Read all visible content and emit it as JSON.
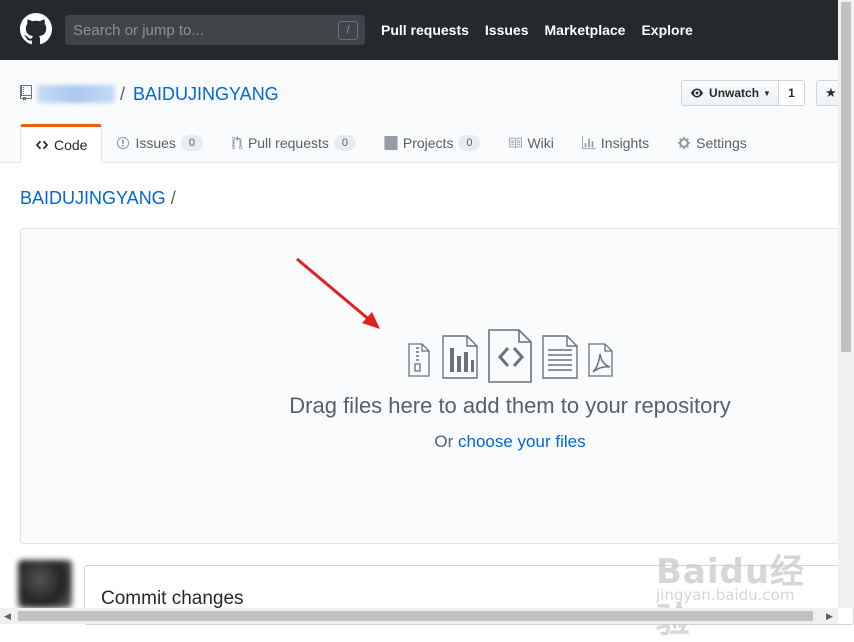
{
  "header": {
    "search_placeholder": "Search or jump to...",
    "slash_hint": "/",
    "nav": [
      "Pull requests",
      "Issues",
      "Marketplace",
      "Explore"
    ]
  },
  "repo": {
    "separator": "/",
    "name": "BAIDUJINGYANG",
    "unwatch_label": "Unwatch",
    "watch_count": "1"
  },
  "tabs": [
    {
      "label": "Code",
      "icon": "code-icon"
    },
    {
      "label": "Issues",
      "count": "0",
      "icon": "issue-icon"
    },
    {
      "label": "Pull requests",
      "count": "0",
      "icon": "pull-request-icon"
    },
    {
      "label": "Projects",
      "count": "0",
      "icon": "project-icon"
    },
    {
      "label": "Wiki",
      "icon": "book-icon"
    },
    {
      "label": "Insights",
      "icon": "graph-icon"
    },
    {
      "label": "Settings",
      "icon": "gear-icon"
    }
  ],
  "breadcrumb": {
    "repo": "BAIDUJINGYANG",
    "separator": "/"
  },
  "upload": {
    "title": "Drag files here to add them to your repository",
    "or_text": "Or ",
    "choose_link": "choose your files"
  },
  "commit": {
    "title": "Commit changes"
  },
  "watermark": {
    "main": "Baidu经验",
    "sub": "jingyan.baidu.com"
  },
  "colors": {
    "header_bg": "#24292e",
    "link": "#0366d6",
    "active_tab_accent": "#e36209",
    "annotation_arrow": "#e02020"
  }
}
